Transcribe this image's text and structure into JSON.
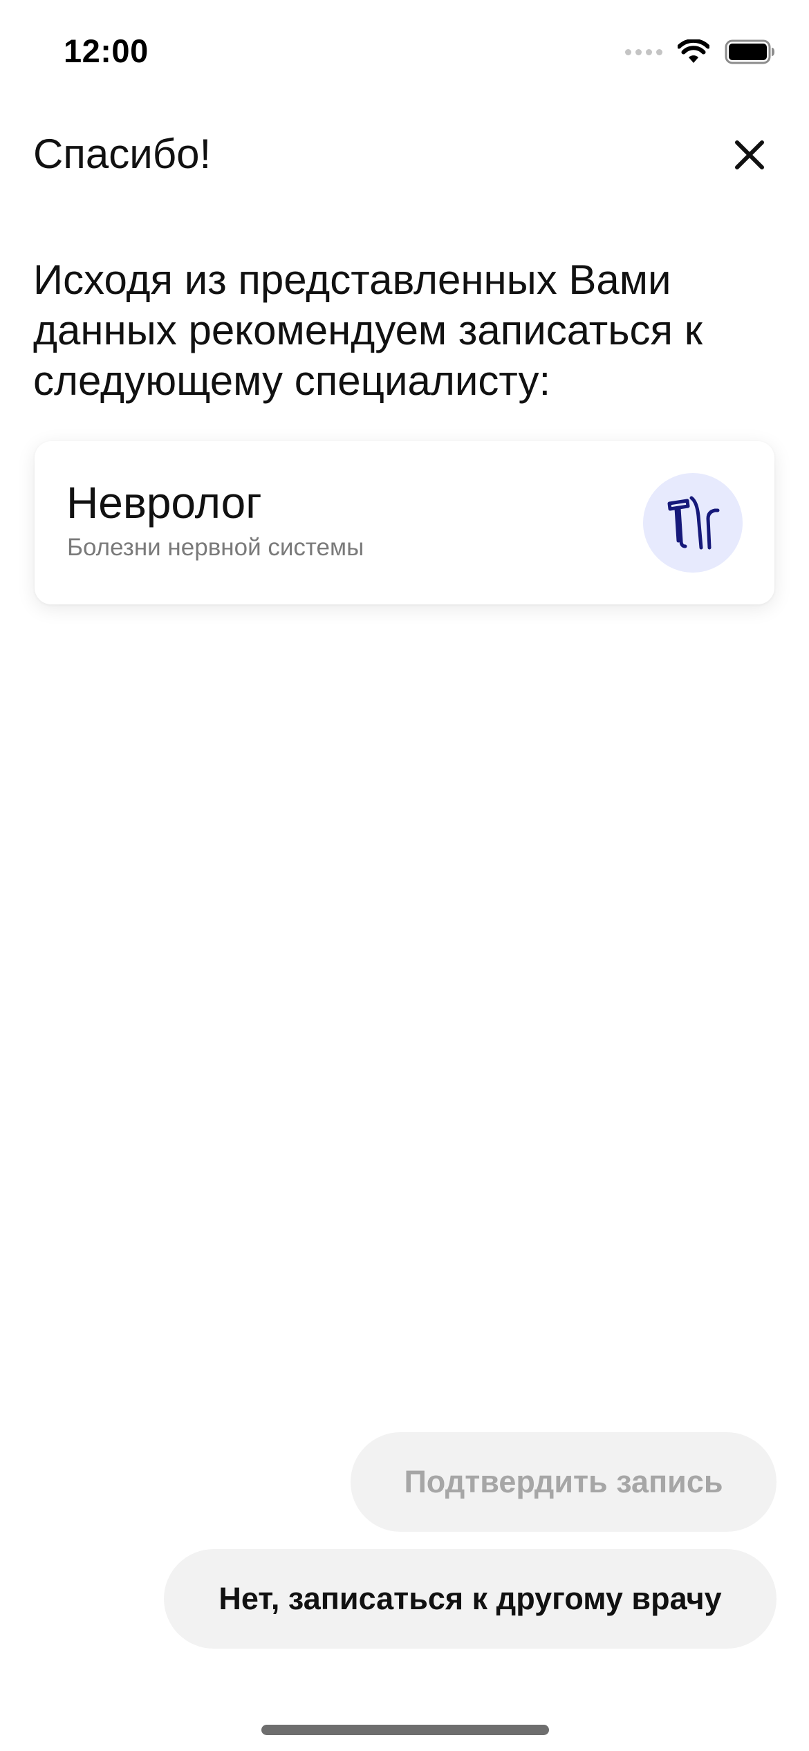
{
  "status_bar": {
    "time": "12:00",
    "signal_icon": "signal-dots-icon",
    "wifi_icon": "wifi-icon",
    "battery_icon": "battery-icon"
  },
  "header": {
    "title": "Спасибо!",
    "close_icon": "close-icon"
  },
  "intro": {
    "text": "Исходя из представленных Вами данных рекомендуем записаться к следующему специалисту:"
  },
  "specialist_card": {
    "title": "Невролог",
    "subtitle": "Болезни нервной системы",
    "icon": "reflex-hammer-icon",
    "icon_bg_color": "#e7eafd",
    "icon_color": "#16197a"
  },
  "actions": {
    "confirm_label": "Подтвердить запись",
    "other_doctor_label": "Нет, записаться к другому врачу"
  },
  "colors": {
    "button_bg": "#f2f2f2",
    "disabled_text": "#a6a6a6",
    "subtitle_text": "#7a7a7a"
  }
}
